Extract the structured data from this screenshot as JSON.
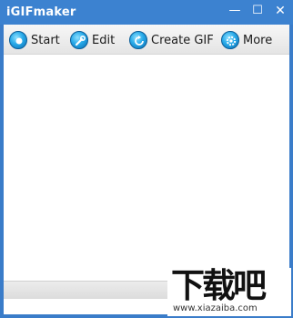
{
  "window": {
    "title": "iGIFmaker",
    "controls": {
      "minimize": "—",
      "maximize": "☐",
      "close": "✕"
    }
  },
  "toolbar": {
    "items": [
      {
        "label": "Start",
        "icon": "start-icon"
      },
      {
        "label": "Edit",
        "icon": "wrench-icon"
      },
      {
        "label": "Create GIF",
        "icon": "refresh-icon"
      },
      {
        "label": "More",
        "icon": "gear-icon"
      }
    ]
  },
  "watermark": {
    "logo": "下载吧",
    "url": "www.xiazaiba.com"
  },
  "colors": {
    "title_bar": "#3c82d0",
    "icon_accent": "#27a9e8"
  }
}
